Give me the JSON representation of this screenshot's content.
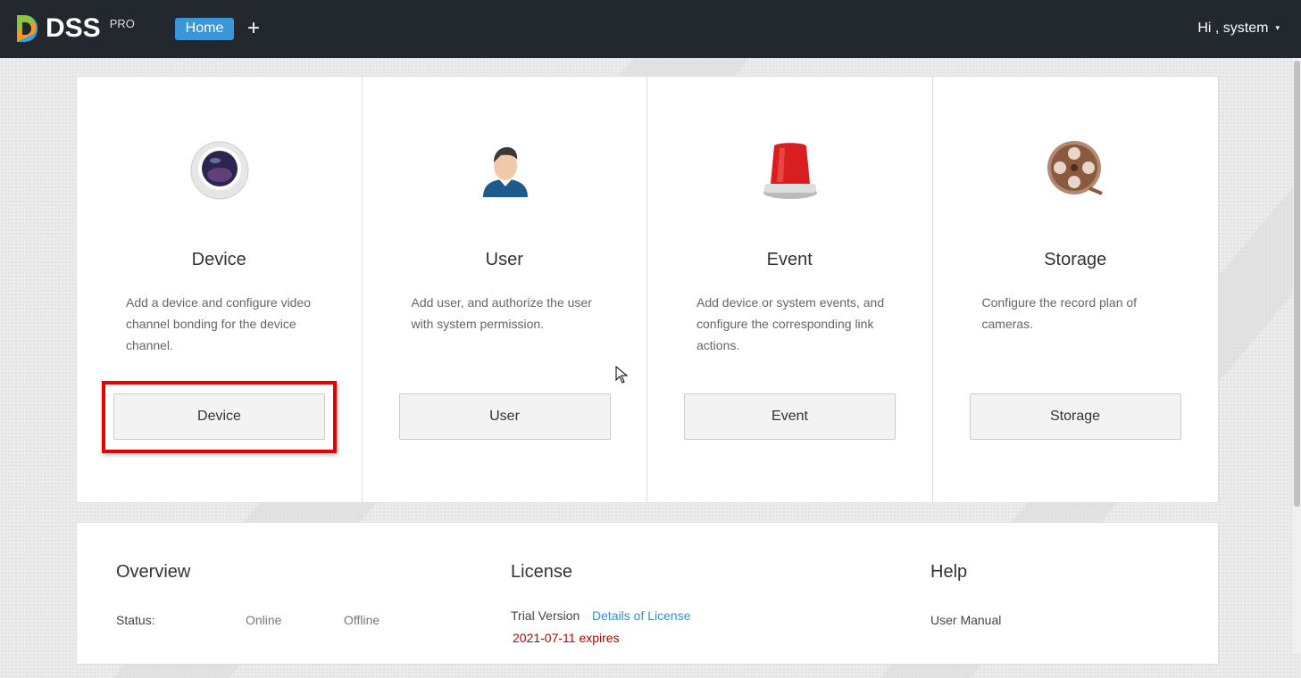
{
  "header": {
    "logo": "DSS",
    "logo_sub": "PRO",
    "home_tab": "Home",
    "add_tab": "+",
    "greeting": "Hi , system",
    "caret": "▾"
  },
  "modules": [
    {
      "title": "Device",
      "desc": "Add a device and configure video channel bonding for the device channel.",
      "button": "Device",
      "icon": "camera-icon"
    },
    {
      "title": "User",
      "desc": "Add user, and authorize the user with system permission.",
      "button": "User",
      "icon": "user-icon"
    },
    {
      "title": "Event",
      "desc": "Add device or system events, and configure the corresponding link actions.",
      "button": "Event",
      "icon": "alarm-light-icon"
    },
    {
      "title": "Storage",
      "desc": "Configure the record plan of cameras.",
      "button": "Storage",
      "icon": "film-reel-icon"
    }
  ],
  "overview": {
    "title": "Overview",
    "status_label": "Status:",
    "online": "Online",
    "offline": "Offline"
  },
  "license": {
    "title": "License",
    "version": "Trial Version",
    "details_link": "Details of License",
    "expires": "2021-07-11 expires"
  },
  "help": {
    "title": "Help",
    "manual": "User Manual"
  },
  "colors": {
    "accent": "#3a96d8",
    "highlight": "#e60000",
    "expires": "#b30000",
    "link": "#3a8fc8"
  }
}
